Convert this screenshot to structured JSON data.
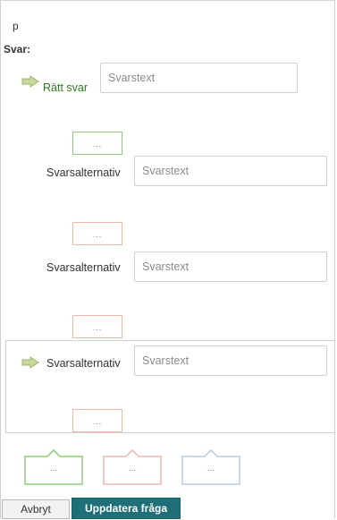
{
  "question": {
    "text": "p"
  },
  "answers": {
    "section_label": "Svar:",
    "correct": {
      "label": "Rätt svar",
      "placeholder": "Svarstext",
      "comment_button": "..."
    },
    "alternatives": [
      {
        "label": "Svarsalternativ",
        "placeholder": "Svarstext",
        "comment_button": "..."
      },
      {
        "label": "Svarsalternativ",
        "placeholder": "Svarstext",
        "comment_button": "..."
      },
      {
        "label": "Svarsalternativ",
        "placeholder": "Svarstext",
        "comment_button": "..."
      }
    ]
  },
  "general_comments": {
    "correct": "...",
    "incorrect": "...",
    "neutral": "..."
  },
  "colors": {
    "correct_green": "#8fcd7a",
    "incorrect_red": "#f0b6b0",
    "neutral_blue": "#b9cde6",
    "correct_label": "#2e7d1f",
    "primary_button": "#1f6f78",
    "arrow_fill": "#c7d9a0"
  },
  "footer": {
    "cancel_label": "Avbryt",
    "update_label": "Uppdatera fråga"
  }
}
